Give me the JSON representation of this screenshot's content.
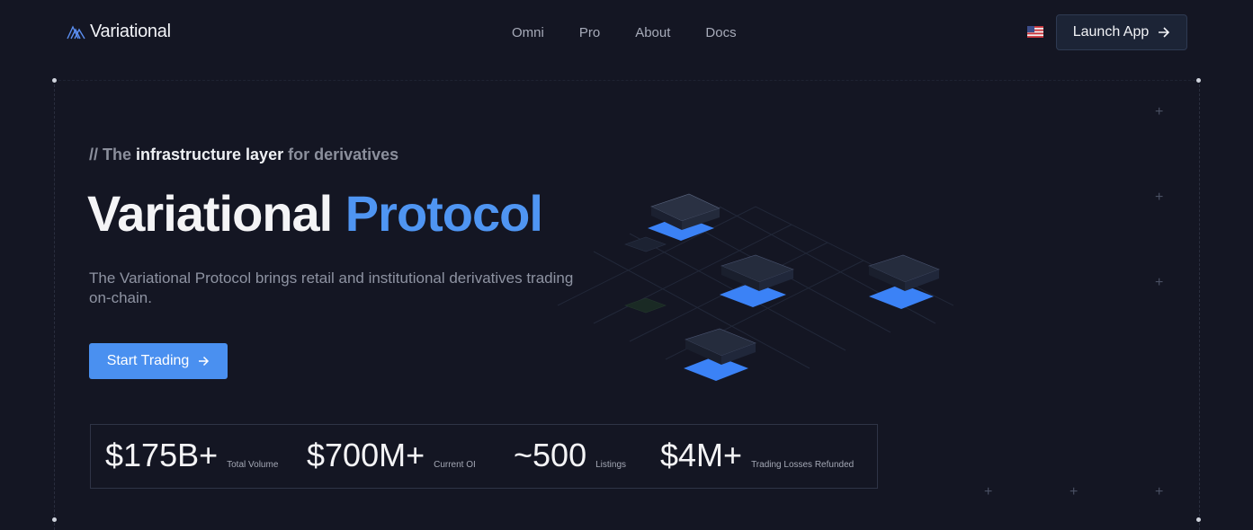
{
  "nav": {
    "brand": "Variational",
    "links": [
      "Omni",
      "Pro",
      "About",
      "Docs"
    ],
    "launch_label": "Launch App"
  },
  "hero": {
    "eyebrow_prefix": "// The ",
    "eyebrow_strong": "infrastructure layer",
    "eyebrow_suffix": " for derivatives",
    "title_main": "Variational ",
    "title_accent": "Protocol",
    "description": "The Variational Protocol brings retail and institutional derivatives trading on-chain.",
    "cta_label": "Start Trading"
  },
  "stats": [
    {
      "value": "$175B+",
      "label": "Total Volume"
    },
    {
      "value": "$700M+",
      "label": "Current OI"
    },
    {
      "value": "~500",
      "label": "Listings"
    },
    {
      "value": "$4M+",
      "label": "Trading Losses Refunded"
    }
  ],
  "colors": {
    "background": "#141623",
    "accent": "#4f95f2",
    "button": "#4a90f0"
  },
  "icons": [
    "variational-logo-icon",
    "us-flag-icon",
    "arrow-right-icon"
  ]
}
